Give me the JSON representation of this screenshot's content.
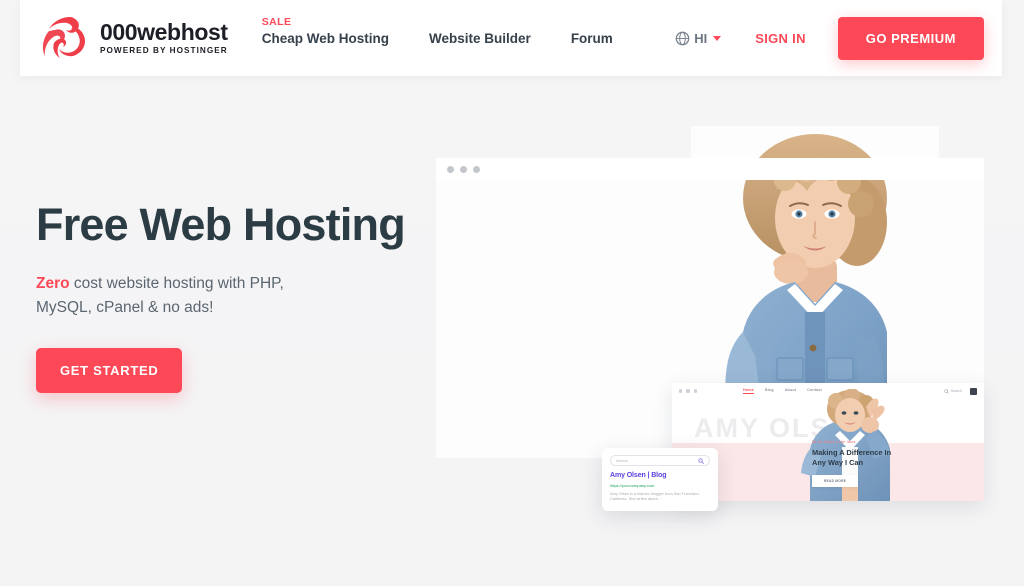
{
  "header": {
    "logo": {
      "mark": "flame-swirl-logo",
      "title": "000webhost",
      "subtitle": "POWERED BY HOSTINGER"
    },
    "nav": [
      {
        "label": "Cheap Web Hosting",
        "tag": "SALE"
      },
      {
        "label": "Website Builder",
        "tag": ""
      },
      {
        "label": "Forum",
        "tag": ""
      }
    ],
    "language": {
      "label": "HI",
      "icon": "globe-icon",
      "caret": "chevron-down-icon"
    },
    "sign_in": "SIGN IN",
    "premium_button": "GO PREMIUM"
  },
  "hero": {
    "title": "Free Web Hosting",
    "subtitle_highlight": "Zero",
    "subtitle_rest": " cost website hosting with PHP, MySQL, cPanel & no ads!",
    "cta": "GET STARTED"
  },
  "mockup": {
    "inner_site": {
      "nav_items": [
        "Home",
        "Blog",
        "About",
        "Contact"
      ],
      "search_label": "Search",
      "watermark": "AMY OLSEN",
      "promo": {
        "eyebrow": "Be an Olsen | she likes",
        "title": "Making A Difference In Any Way I Can",
        "button": "READ MORE"
      }
    },
    "search_card": {
      "search_value": "fashion",
      "search_icon": "magnifier-icon",
      "result_title": "Amy Olsen | Blog",
      "result_url": "https://yourcompany.com",
      "result_description": "Amy Olsen is a fashion blogger from San Francisco, California. She writes about..."
    }
  },
  "colors": {
    "accent_red": "#fc4857",
    "dark_slate": "#2c3c44",
    "page_bg": "#f4f4f5",
    "link_purple": "#5b3ee0",
    "url_green": "#1aa260",
    "pink_band": "#fbe7e8"
  }
}
